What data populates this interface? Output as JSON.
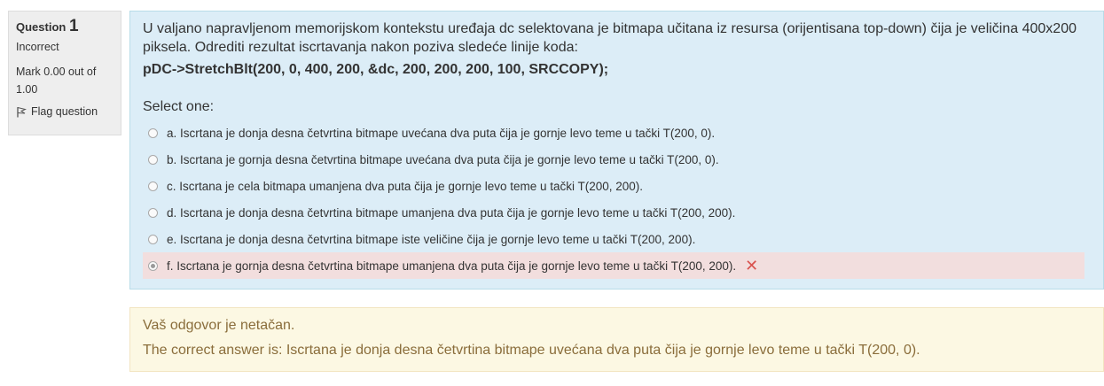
{
  "info": {
    "question_label": "Question",
    "question_number": "1",
    "state": "Incorrect",
    "grade": "Mark 0.00 out of 1.00",
    "flag_label": "Flag question",
    "flag_icon": "flag-icon"
  },
  "question": {
    "text": "U valjano napravljenom memorijskom kontekstu uređaja dc selektovana je bitmapa učitana iz resursa (orijentisana top-down) čija je veličina 400x200 piksela. Odrediti rezultat iscrtavanja nakon poziva sledeće linije koda:",
    "code": "pDC->StretchBlt(200, 0, 400, 200, &dc, 200, 200, 200, 100, SRCCOPY);",
    "prompt": "Select one:",
    "answers": [
      {
        "text": "a. Iscrtana je donja desna četvrtina bitmape uvećana dva puta čija je gornje levo teme u tački T(200, 0).",
        "selected": false
      },
      {
        "text": "b. Iscrtana je gornja desna četvrtina bitmape uvećana dva puta čija je gornje levo teme u tački T(200, 0).",
        "selected": false
      },
      {
        "text": "c. Iscrtana je cela bitmapa umanjena dva puta čija je gornje levo teme u tački T(200, 200).",
        "selected": false
      },
      {
        "text": "d. Iscrtana je donja desna četvrtina bitmape umanjena dva puta čija je gornje levo teme u tački T(200, 200).",
        "selected": false
      },
      {
        "text": "e. Iscrtana je donja desna četvrtina bitmape iste veličine čija je gornje levo teme u tački T(200, 200).",
        "selected": false
      },
      {
        "text": "f. Iscrtana je gornja desna četvrtina bitmape umanjena dva puta čija je gornje levo teme u tački T(200, 200).",
        "selected": true
      }
    ]
  },
  "outcome": {
    "feedback": "Vaš odgovor je netačan.",
    "right_answer": "The correct answer is: Iscrtana je donja desna četvrtina bitmape uvećana dva puta čija je gornje levo teme u tački T(200, 0)."
  },
  "colors": {
    "formulation_bg": "#dcedf7",
    "incorrect_bg": "#f2dede",
    "outcome_bg": "#fcf8e3",
    "outcome_text": "#8a6d3b",
    "wrong_icon": "#d9534f"
  }
}
